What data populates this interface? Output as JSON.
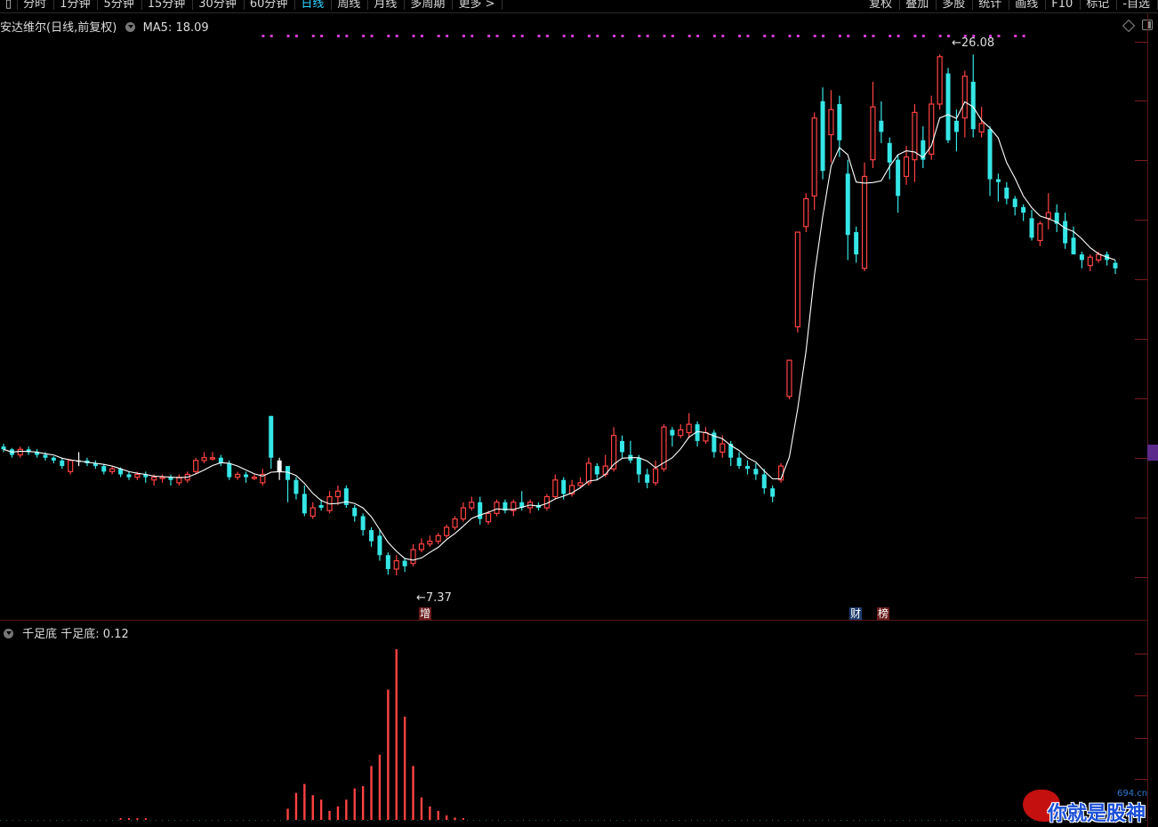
{
  "toolbar": {
    "left_items": [
      "分时",
      "1分钟",
      "5分钟",
      "15分钟",
      "30分钟",
      "60分钟",
      "日线",
      "周线",
      "月线",
      "多周期",
      "更多 >"
    ],
    "active_index": 6,
    "right_items": [
      "复权",
      "叠加",
      "多股",
      "统计",
      "画线",
      "F10",
      "标记",
      "-自选"
    ]
  },
  "chart_header": {
    "title": "安达维尔(日线,前复权)",
    "ma_label": "MA5: 18.09"
  },
  "annotations": {
    "low_price": "7.37",
    "high_price": "26.08",
    "tag_zeng": "增",
    "tag_cai": "财",
    "tag_bang": "榜"
  },
  "indicator": {
    "name": "千足底",
    "value_label": "千足底: 0.12"
  },
  "watermark": {
    "text": "你就是股神",
    "url": "694.cn"
  },
  "colors": {
    "up": "#ff4242",
    "down": "#35e6e6",
    "ma": "#ffffff",
    "grid": "#7a1a1a",
    "signal": "#d43bd4",
    "indicator_bar": "#ff4242"
  },
  "chart_data": {
    "type": "candlestick",
    "title": "安达维尔(日线,前复权)",
    "low_marked": 7.37,
    "high_marked": 26.08,
    "ma5_last": 18.09,
    "candles": [
      [
        12.0,
        11.9,
        12.1,
        11.8
      ],
      [
        11.9,
        11.7,
        11.95,
        11.6
      ],
      [
        11.7,
        11.9,
        12.0,
        11.6
      ],
      [
        11.9,
        11.8,
        12.0,
        11.7
      ],
      [
        11.8,
        11.7,
        11.9,
        11.6
      ],
      [
        11.7,
        11.6,
        11.8,
        11.5
      ],
      [
        11.6,
        11.5,
        11.65,
        11.4
      ],
      [
        11.5,
        11.3,
        11.6,
        11.2
      ],
      [
        11.1,
        11.5,
        11.55,
        11.0
      ],
      [
        11.5,
        11.5,
        11.8,
        11.3
      ],
      [
        11.5,
        11.4,
        11.6,
        11.3
      ],
      [
        11.4,
        11.3,
        11.5,
        11.2
      ],
      [
        11.3,
        11.1,
        11.35,
        11.0
      ],
      [
        11.1,
        11.2,
        11.3,
        11.0
      ],
      [
        11.2,
        11.0,
        11.25,
        10.9
      ],
      [
        11.0,
        10.9,
        11.1,
        10.8
      ],
      [
        10.9,
        11.0,
        11.1,
        10.8
      ],
      [
        11.0,
        10.9,
        11.1,
        10.7
      ],
      [
        10.8,
        10.9,
        11.0,
        10.6
      ],
      [
        10.9,
        10.9,
        11.0,
        10.7
      ],
      [
        10.9,
        10.8,
        11.0,
        10.6
      ],
      [
        10.7,
        10.9,
        11.0,
        10.6
      ],
      [
        10.8,
        11.0,
        11.1,
        10.7
      ],
      [
        11.1,
        11.5,
        11.6,
        11.0
      ],
      [
        11.5,
        11.6,
        11.8,
        11.4
      ],
      [
        11.6,
        11.6,
        11.8,
        11.5
      ],
      [
        11.6,
        11.4,
        11.7,
        11.3
      ],
      [
        11.4,
        10.9,
        11.5,
        10.8
      ],
      [
        10.9,
        11.0,
        11.1,
        10.8
      ],
      [
        11.0,
        10.9,
        11.1,
        10.7
      ],
      [
        10.9,
        10.9,
        11.0,
        10.8
      ],
      [
        10.7,
        11.0,
        11.2,
        10.6
      ],
      [
        13.1,
        11.6,
        13.1,
        11.2
      ],
      [
        11.5,
        11.1,
        11.6,
        10.8
      ],
      [
        11.3,
        10.8,
        11.3,
        10.0
      ],
      [
        10.8,
        10.3,
        10.9,
        10.1
      ],
      [
        10.3,
        9.6,
        10.6,
        9.5
      ],
      [
        9.5,
        9.8,
        10.0,
        9.4
      ],
      [
        9.9,
        9.8,
        10.1,
        9.7
      ],
      [
        9.7,
        10.2,
        10.4,
        9.6
      ],
      [
        10.2,
        10.4,
        10.6,
        9.9
      ],
      [
        10.5,
        9.9,
        10.6,
        9.8
      ],
      [
        9.8,
        9.5,
        9.9,
        9.3
      ],
      [
        9.5,
        9.0,
        9.6,
        8.8
      ],
      [
        9.0,
        8.6,
        9.1,
        8.4
      ],
      [
        8.8,
        8.1,
        9.0,
        7.9
      ],
      [
        8.1,
        7.6,
        8.2,
        7.4
      ],
      [
        7.6,
        7.9,
        8.1,
        7.37
      ],
      [
        7.9,
        7.7,
        8.0,
        7.5
      ],
      [
        7.8,
        8.3,
        8.5,
        7.7
      ],
      [
        8.3,
        8.5,
        8.7,
        8.2
      ],
      [
        8.5,
        8.6,
        8.8,
        8.4
      ],
      [
        8.6,
        8.8,
        8.9,
        8.5
      ],
      [
        8.8,
        9.1,
        9.2,
        8.7
      ],
      [
        9.1,
        9.4,
        9.5,
        9.0
      ],
      [
        9.4,
        9.8,
        10.0,
        9.3
      ],
      [
        9.8,
        10.0,
        10.2,
        9.7
      ],
      [
        10.0,
        9.4,
        10.2,
        9.2
      ],
      [
        9.3,
        9.6,
        9.7,
        9.2
      ],
      [
        9.6,
        10.0,
        10.1,
        9.5
      ],
      [
        10.0,
        9.7,
        10.1,
        9.6
      ],
      [
        9.7,
        10.0,
        10.1,
        9.5
      ],
      [
        10.0,
        9.8,
        10.4,
        9.7
      ],
      [
        9.8,
        10.0,
        10.1,
        9.6
      ],
      [
        9.9,
        9.8,
        10.0,
        9.7
      ],
      [
        9.8,
        10.2,
        10.3,
        9.7
      ],
      [
        10.2,
        10.8,
        11.0,
        10.1
      ],
      [
        10.8,
        10.3,
        10.9,
        10.1
      ],
      [
        10.3,
        10.6,
        10.8,
        10.2
      ],
      [
        10.6,
        10.7,
        10.9,
        10.5
      ],
      [
        10.7,
        11.4,
        11.6,
        10.6
      ],
      [
        11.3,
        11.0,
        11.4,
        10.8
      ],
      [
        11.0,
        11.3,
        11.7,
        10.9
      ],
      [
        11.2,
        12.4,
        12.7,
        11.1
      ],
      [
        12.2,
        11.8,
        12.4,
        11.6
      ],
      [
        11.7,
        11.5,
        12.2,
        11.4
      ],
      [
        11.6,
        11.0,
        11.7,
        10.7
      ],
      [
        11.0,
        10.7,
        11.2,
        10.5
      ],
      [
        10.7,
        11.2,
        11.5,
        10.6
      ],
      [
        11.2,
        12.7,
        12.8,
        11.1
      ],
      [
        12.6,
        12.4,
        12.7,
        12.0
      ],
      [
        12.4,
        12.6,
        12.8,
        12.3
      ],
      [
        12.5,
        12.8,
        13.2,
        12.3
      ],
      [
        12.8,
        12.2,
        12.9,
        12.0
      ],
      [
        12.2,
        12.5,
        12.7,
        12.1
      ],
      [
        12.5,
        11.8,
        12.6,
        11.6
      ],
      [
        11.8,
        12.1,
        12.4,
        11.6
      ],
      [
        12.1,
        11.6,
        12.2,
        11.3
      ],
      [
        11.6,
        11.3,
        11.8,
        11.2
      ],
      [
        11.3,
        11.2,
        11.5,
        11.0
      ],
      [
        11.2,
        11.0,
        11.4,
        10.8
      ],
      [
        11.0,
        10.5,
        11.2,
        10.3
      ],
      [
        10.5,
        10.2,
        10.6,
        10.0
      ],
      [
        10.8,
        11.3,
        11.4,
        10.7
      ],
      [
        13.8,
        15.1,
        15.1,
        13.7
      ],
      [
        16.3,
        19.7,
        19.7,
        16.1
      ],
      [
        19.9,
        20.9,
        21.1,
        19.7
      ],
      [
        21.0,
        23.8,
        24.0,
        20.5
      ],
      [
        24.4,
        21.9,
        24.9,
        21.6
      ],
      [
        23.2,
        24.1,
        24.8,
        22.2
      ],
      [
        24.3,
        23.0,
        24.6,
        22.4
      ],
      [
        21.8,
        19.6,
        22.3,
        18.7
      ],
      [
        19.7,
        18.9,
        19.9,
        18.6
      ],
      [
        18.4,
        21.7,
        22.2,
        18.3
      ],
      [
        22.3,
        24.2,
        25.1,
        22.0
      ],
      [
        23.7,
        23.3,
        24.4,
        22.9
      ],
      [
        22.9,
        22.2,
        23.1,
        21.6
      ],
      [
        22.3,
        21.0,
        22.5,
        20.4
      ],
      [
        21.7,
        22.4,
        22.8,
        21.4
      ],
      [
        22.3,
        24.0,
        24.3,
        21.5
      ],
      [
        23.0,
        22.3,
        23.5,
        22.0
      ],
      [
        22.5,
        24.3,
        24.6,
        22.3
      ],
      [
        24.3,
        26.0,
        26.08,
        24.1
      ],
      [
        25.4,
        23.0,
        25.6,
        22.9
      ],
      [
        23.7,
        23.3,
        24.1,
        22.6
      ],
      [
        23.8,
        25.3,
        25.5,
        23.1
      ],
      [
        25.1,
        23.4,
        26.08,
        23.1
      ],
      [
        23.3,
        23.6,
        24.2,
        23.1
      ],
      [
        23.4,
        21.6,
        23.5,
        21.0
      ],
      [
        21.6,
        21.5,
        21.8,
        20.8
      ],
      [
        21.3,
        20.9,
        21.5,
        20.7
      ],
      [
        20.9,
        20.6,
        21.0,
        20.3
      ],
      [
        20.6,
        20.4,
        20.7,
        20.1
      ],
      [
        20.2,
        19.5,
        20.5,
        19.4
      ],
      [
        19.4,
        20.0,
        20.1,
        19.2
      ],
      [
        20.2,
        20.4,
        21.1,
        19.8
      ],
      [
        20.4,
        20.0,
        20.7,
        19.7
      ],
      [
        20.1,
        19.3,
        20.4,
        19.1
      ],
      [
        19.5,
        18.9,
        19.9,
        18.9
      ],
      [
        18.9,
        18.7,
        19.0,
        18.4
      ],
      [
        18.5,
        18.8,
        18.9,
        18.3
      ],
      [
        18.7,
        18.9,
        19.0,
        18.6
      ],
      [
        18.9,
        18.7,
        19.0,
        18.5
      ],
      [
        18.6,
        18.4,
        18.7,
        18.2
      ]
    ],
    "indicator_values": [
      0,
      0,
      0,
      0,
      0,
      0,
      0,
      0,
      0,
      0,
      0,
      0,
      0,
      0,
      0,
      0,
      0,
      0,
      0,
      0,
      0,
      0,
      0,
      0,
      0,
      0,
      0,
      0,
      0,
      0,
      0,
      0,
      0,
      0,
      0.5,
      1.2,
      1.6,
      1.1,
      0.9,
      0.4,
      0.6,
      0.9,
      1.4,
      1.5,
      2.4,
      2.9,
      5.8,
      7.6,
      4.6,
      2.4,
      1.0,
      0.6,
      0.4,
      0.2,
      0.1,
      0,
      0,
      0,
      0,
      0,
      0,
      0,
      0,
      0,
      0,
      0,
      0,
      0,
      0,
      0,
      0,
      0,
      0,
      0,
      0,
      0,
      0,
      0,
      0,
      0,
      0,
      0,
      0,
      0,
      0,
      0,
      0,
      0,
      0,
      0,
      0,
      0,
      0,
      0,
      0,
      0,
      0,
      0,
      0,
      0,
      0,
      0,
      0,
      0,
      0,
      0,
      0,
      0,
      0,
      0,
      0,
      0,
      0,
      0,
      0,
      0,
      0,
      0,
      0,
      0,
      0,
      0,
      0,
      0,
      0,
      0,
      0,
      0,
      0,
      0,
      0,
      0,
      0,
      0,
      0,
      0,
      0
    ]
  }
}
